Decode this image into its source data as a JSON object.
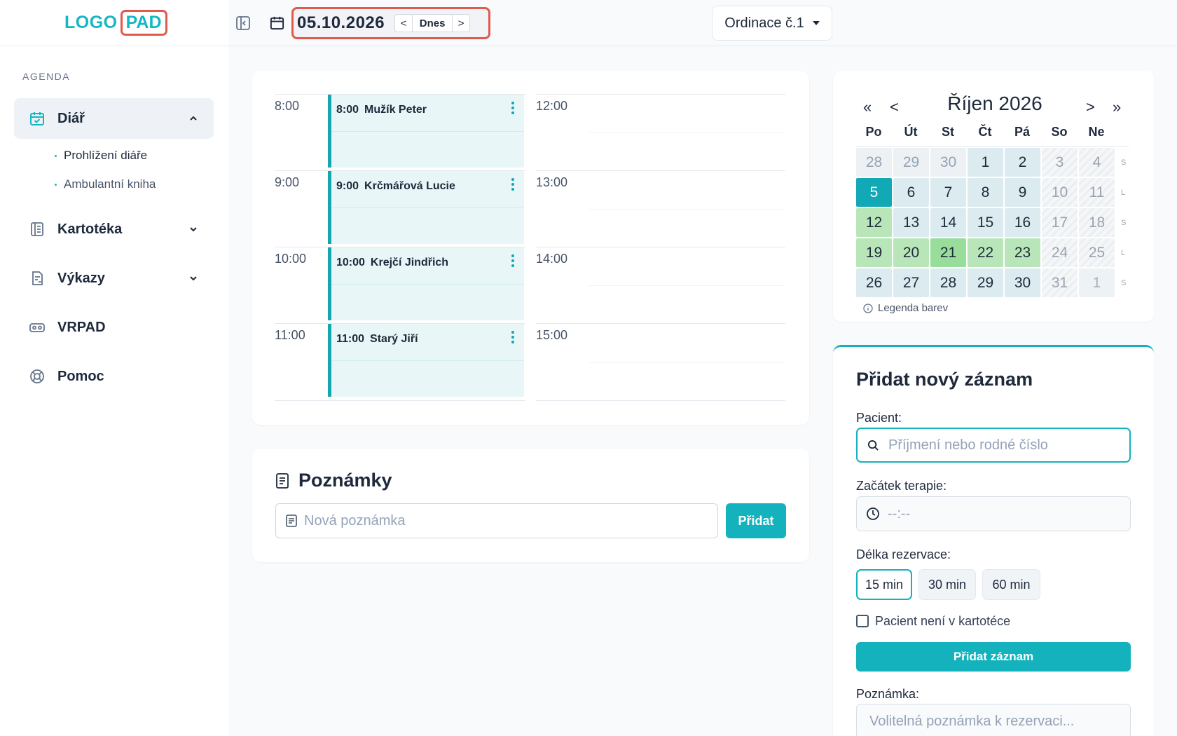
{
  "brand": {
    "logo_left": "LOGO",
    "logo_right": "PAD",
    "accent": "#14b8c4",
    "highlight": "#e05a4e"
  },
  "sidebar": {
    "section_label": "AGENDA",
    "items": [
      {
        "label": "Diář",
        "icon": "calendar-check-icon",
        "expanded": true,
        "children": [
          {
            "label": "Prohlížení diáře"
          },
          {
            "label": "Ambulantní kniha"
          }
        ]
      },
      {
        "label": "Kartotéka",
        "icon": "book-icon"
      },
      {
        "label": "Výkazy",
        "icon": "report-icon"
      },
      {
        "label": "VRPAD",
        "icon": "vr-headset-icon"
      },
      {
        "label": "Pomoc",
        "icon": "lifebuoy-icon"
      }
    ]
  },
  "topbar": {
    "date": "05.10.2026",
    "today_label": "Dnes",
    "prev_glyph": "<",
    "next_glyph": ">",
    "office_label": "Ordinace č.1"
  },
  "schedule": {
    "left_times": [
      "8:00",
      "9:00",
      "10:00",
      "11:00"
    ],
    "right_times": [
      "12:00",
      "13:00",
      "14:00",
      "15:00"
    ],
    "appointments": [
      {
        "time": "8:00",
        "name": "Mužík Peter"
      },
      {
        "time": "9:00",
        "name": "Krčmářová Lucie"
      },
      {
        "time": "10:00",
        "name": "Krejčí Jindřich"
      },
      {
        "time": "11:00",
        "name": "Starý Jiří"
      }
    ]
  },
  "notes": {
    "title": "Poznámky",
    "placeholder": "Nová poznámka",
    "add_label": "Přidat"
  },
  "calendar": {
    "title": "Říjen 2026",
    "nav": {
      "prev_year": "«",
      "prev_month": "<",
      "next_month": ">",
      "next_year": "»"
    },
    "weekdays": [
      "Po",
      "Út",
      "St",
      "Čt",
      "Pá",
      "So",
      "Ne"
    ],
    "weeks": [
      {
        "days": [
          "28",
          "29",
          "30",
          "1",
          "2",
          "3",
          "4"
        ],
        "types": [
          "out",
          "out",
          "out",
          "blue",
          "blue",
          "wknd",
          "wknd"
        ],
        "side": "S"
      },
      {
        "days": [
          "5",
          "6",
          "7",
          "8",
          "9",
          "10",
          "11"
        ],
        "types": [
          "today",
          "blue",
          "blue",
          "blue",
          "blue",
          "wknd",
          "wknd"
        ],
        "side": "L"
      },
      {
        "days": [
          "12",
          "13",
          "14",
          "15",
          "16",
          "17",
          "18"
        ],
        "types": [
          "green",
          "blue",
          "blue",
          "blue",
          "blue",
          "wknd",
          "wknd"
        ],
        "side": "S"
      },
      {
        "days": [
          "19",
          "20",
          "21",
          "22",
          "23",
          "24",
          "25"
        ],
        "types": [
          "green",
          "green",
          "green2",
          "green",
          "green",
          "wknd",
          "wknd"
        ],
        "side": "L"
      },
      {
        "days": [
          "26",
          "27",
          "28",
          "29",
          "30",
          "31",
          "1"
        ],
        "types": [
          "blue",
          "blue",
          "blue",
          "blue",
          "blue",
          "wknd",
          "lastout"
        ],
        "side": "S"
      }
    ],
    "legend_label": "Legenda barev"
  },
  "form": {
    "title": "Přidat nový záznam",
    "patient_label": "Pacient:",
    "patient_placeholder": "Příjmení nebo rodné číslo",
    "start_label": "Začátek terapie:",
    "start_placeholder": "--:--",
    "duration_label": "Délka rezervace:",
    "durations": [
      "15 min",
      "30 min",
      "60 min"
    ],
    "selected_duration": "15 min",
    "checkbox_label": "Pacient není v kartotéce",
    "submit_label": "Přidat záznam",
    "note_label": "Poznámka:",
    "note_placeholder": "Volitelná poznámka k rezervaci..."
  }
}
